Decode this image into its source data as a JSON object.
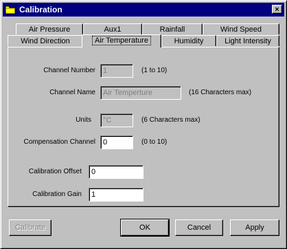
{
  "window": {
    "title": "Calibration",
    "close_label": "×"
  },
  "tabs_back": [
    {
      "label": "Air Pressure"
    },
    {
      "label": "Aux1"
    },
    {
      "label": "Rainfall"
    },
    {
      "label": "Wind Speed"
    }
  ],
  "tabs_front": [
    {
      "label": "Wind Direction"
    },
    {
      "label": "Air Temperature"
    },
    {
      "label": "Humidity"
    },
    {
      "label": "Light Intensity"
    }
  ],
  "form": {
    "channel_number": {
      "label": "Channel Number",
      "value": "1",
      "hint": "(1 to 10)"
    },
    "channel_name": {
      "label": "Channel Name",
      "value": "Air Temperture",
      "hint": "(16 Characters max)"
    },
    "units": {
      "label": "Units",
      "value": "°C",
      "hint": "(6 Characters max)"
    },
    "compensation_channel": {
      "label": "Compensation Channel",
      "value": "0",
      "hint": "(0 to 10)"
    },
    "calibration_offset": {
      "label": "Calibration Offset",
      "value": "0"
    },
    "calibration_gain": {
      "label": "Calibration Gain",
      "value": "1"
    }
  },
  "buttons": {
    "calibrate": "Calibrate",
    "ok": "OK",
    "cancel": "Cancel",
    "apply": "Apply"
  }
}
